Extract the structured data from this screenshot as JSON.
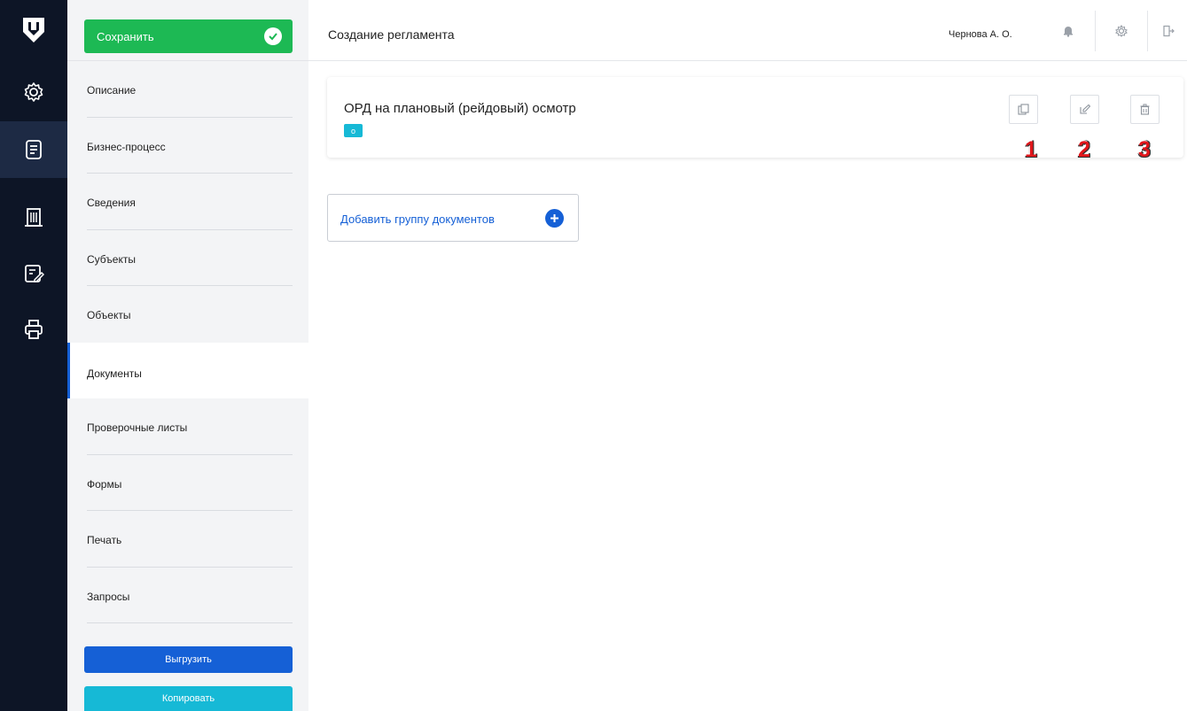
{
  "rail": {
    "items": [
      {
        "icon": "settings-gear-icon"
      },
      {
        "icon": "document-list-icon"
      },
      {
        "icon": "building-icon"
      },
      {
        "icon": "checklist-edit-icon"
      },
      {
        "icon": "printer-icon"
      }
    ],
    "active_index": 1
  },
  "sidebar": {
    "save_label": "Сохранить",
    "menu": [
      {
        "label": "Описание"
      },
      {
        "label": "Бизнес-процесс"
      },
      {
        "label": "Сведения"
      },
      {
        "label": "Субъекты"
      },
      {
        "label": "Объекты"
      },
      {
        "label": "Документы"
      },
      {
        "label": "Проверочные листы"
      },
      {
        "label": "Формы"
      },
      {
        "label": "Печать"
      },
      {
        "label": "Запросы"
      }
    ],
    "active_item": "Документы",
    "export_label": "Выгрузить",
    "copy_label": "Копировать"
  },
  "header": {
    "title": "Создание регламента",
    "user": "Чернова А. О."
  },
  "card": {
    "title": "ОРД на плановый (рейдовый) осмотр",
    "tag": "o",
    "markers": [
      "1",
      "2",
      "3"
    ]
  },
  "add_group": {
    "label": "Добавить группу документов"
  },
  "colors": {
    "rail_bg": "#0d1526",
    "save_green": "#1db954",
    "primary_blue": "#1560d6",
    "cyan": "#16b9d6",
    "marker_red": "#e0161b"
  }
}
